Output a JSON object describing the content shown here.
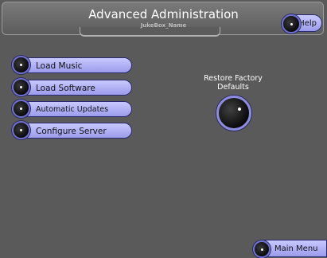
{
  "header": {
    "title": "Advanced Administration",
    "subtitle": "JukeBox_Name"
  },
  "help_button": {
    "label": "Help",
    "icon": "knob-icon"
  },
  "menu": {
    "items": [
      {
        "label": "Load Music"
      },
      {
        "label": "Load Software"
      },
      {
        "label": "Automatic Updates"
      },
      {
        "label": "Configure Server"
      }
    ]
  },
  "restore": {
    "label": "Restore Factory Defaults"
  },
  "main_menu_button": {
    "label": "Main Menu"
  },
  "colors": {
    "background": "#5a5a5a",
    "button": "#b4b4f6",
    "knob_ring": "#7070d0"
  }
}
